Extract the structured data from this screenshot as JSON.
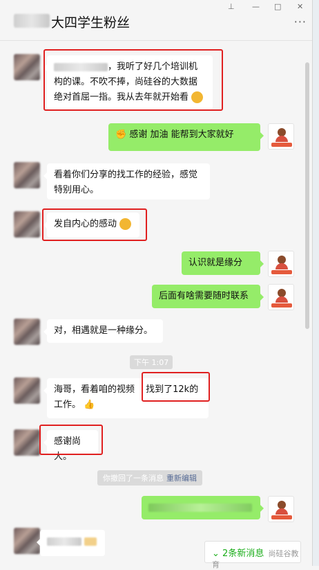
{
  "window": {
    "title": "大四学生粉丝",
    "more": "···",
    "controls": [
      "⊥",
      "—",
      "□",
      "✕"
    ]
  },
  "messages": {
    "m1": "，我听了好几个培训机构的课。不吹不捧，尚硅谷的大数据绝对首屈一指。我从去年就开始看",
    "m2": "感谢   加油  能帮到大家就好",
    "m3": "看着你们分享的找工作的经验，感觉特别用心。",
    "m4": "发自内心的感动",
    "m5": "认识就是缘分",
    "m6": "后面有啥需要随时联系",
    "m7": "对，相遇就是一种缘分。",
    "time": "下午 1:07",
    "m8a": "海哥，看着咱的视频 ",
    "m8b": "找到了12k的",
    "m8c": "工作。",
    "m9": "感谢尚大。",
    "system": "你撤回了一条消息",
    "reedit": "重新编辑"
  },
  "new_messages": {
    "count_label": "2条新消息",
    "watermark": "尚硅谷教育"
  },
  "colors": {
    "my_bubble": "#95ec69",
    "highlight": "#e02020",
    "link": "#576b95"
  }
}
